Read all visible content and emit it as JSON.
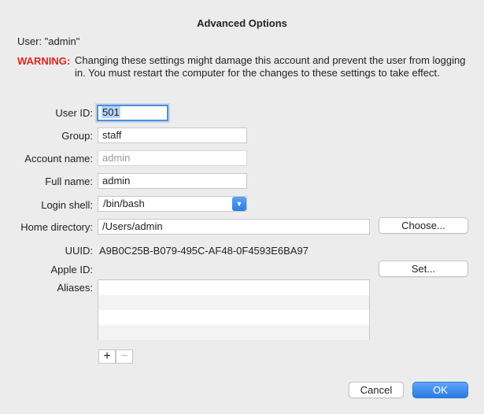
{
  "dialog": {
    "title": "Advanced Options",
    "user_line": "User:  \"admin\"",
    "warning_label": "WARNING:",
    "warning_text": "Changing these settings might damage this account and prevent the user from logging in. You must restart the computer for the changes to these settings to take effect."
  },
  "form": {
    "user_id_label": "User ID:",
    "user_id_value": "501",
    "group_label": "Group:",
    "group_value": "staff",
    "account_name_label": "Account name:",
    "account_name_value": "admin",
    "full_name_label": "Full name:",
    "full_name_value": "admin",
    "login_shell_label": "Login shell:",
    "login_shell_value": "/bin/bash",
    "home_directory_label": "Home directory:",
    "home_directory_value": "/Users/admin",
    "choose_button": "Choose...",
    "uuid_label": "UUID:",
    "uuid_value": "A9B0C25B-B079-495C-AF48-0F4593E6BA97",
    "apple_id_label": "Apple ID:",
    "set_button": "Set...",
    "aliases_label": "Aliases:",
    "add_symbol": "+",
    "remove_symbol": "−"
  },
  "footer": {
    "cancel_button": "Cancel",
    "ok_button": "OK"
  },
  "colors": {
    "warning": "#e0241b",
    "accent": "#2a7ae4",
    "background": "#ececec"
  }
}
